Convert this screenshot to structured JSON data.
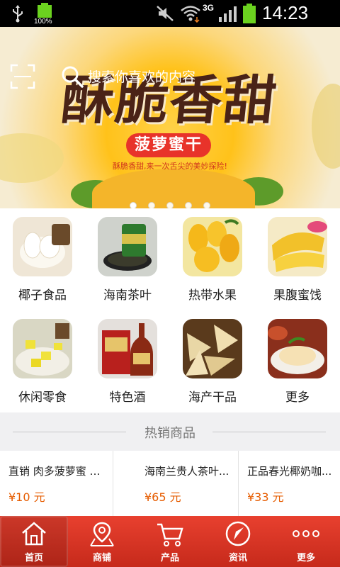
{
  "status_bar": {
    "battery_small_label": "100%",
    "network_label": "3G",
    "time": "14:23"
  },
  "banner": {
    "headline": "酥脆香甜",
    "product_pill": "菠萝蜜干",
    "tagline": "酥脆香甜,来一次舌尖的美妙探险!",
    "slides": 5,
    "active_slide": 0
  },
  "search": {
    "placeholder": "搜索你喜欢的内容"
  },
  "categories": [
    {
      "label": "椰子食品",
      "icon": "coconut-food-image"
    },
    {
      "label": "海南茶叶",
      "icon": "tea-image"
    },
    {
      "label": "热带水果",
      "icon": "mango-image"
    },
    {
      "label": "果腹蜜饯",
      "icon": "candied-fruit-image"
    },
    {
      "label": "休闲零食",
      "icon": "snack-image"
    },
    {
      "label": "特色酒",
      "icon": "liquor-image"
    },
    {
      "label": "海产干品",
      "icon": "dried-seafood-image"
    },
    {
      "label": "更多",
      "icon": "chicken-dish-image"
    }
  ],
  "hot_section": {
    "title": "热销商品"
  },
  "products": [
    {
      "name": "直销 肉多菠萝蜜 可口...",
      "price": "¥10 元"
    },
    {
      "name": "海南兰贵人茶叶...",
      "price": "¥65 元"
    },
    {
      "name": "正品春光椰奶咖...",
      "price": "¥33 元"
    }
  ],
  "tabbar": [
    {
      "label": "首页",
      "icon": "home-icon",
      "active": true
    },
    {
      "label": "商铺",
      "icon": "map-pin-icon",
      "active": false
    },
    {
      "label": "产品",
      "icon": "cart-icon",
      "active": false
    },
    {
      "label": "资讯",
      "icon": "compass-icon",
      "active": false
    },
    {
      "label": "更多",
      "icon": "more-dots-icon",
      "active": false
    }
  ],
  "colors": {
    "accent_red": "#d8321f",
    "price_orange": "#e65c00",
    "banner_yellow": "#ffc21a",
    "battery_green": "#6bd21f"
  }
}
